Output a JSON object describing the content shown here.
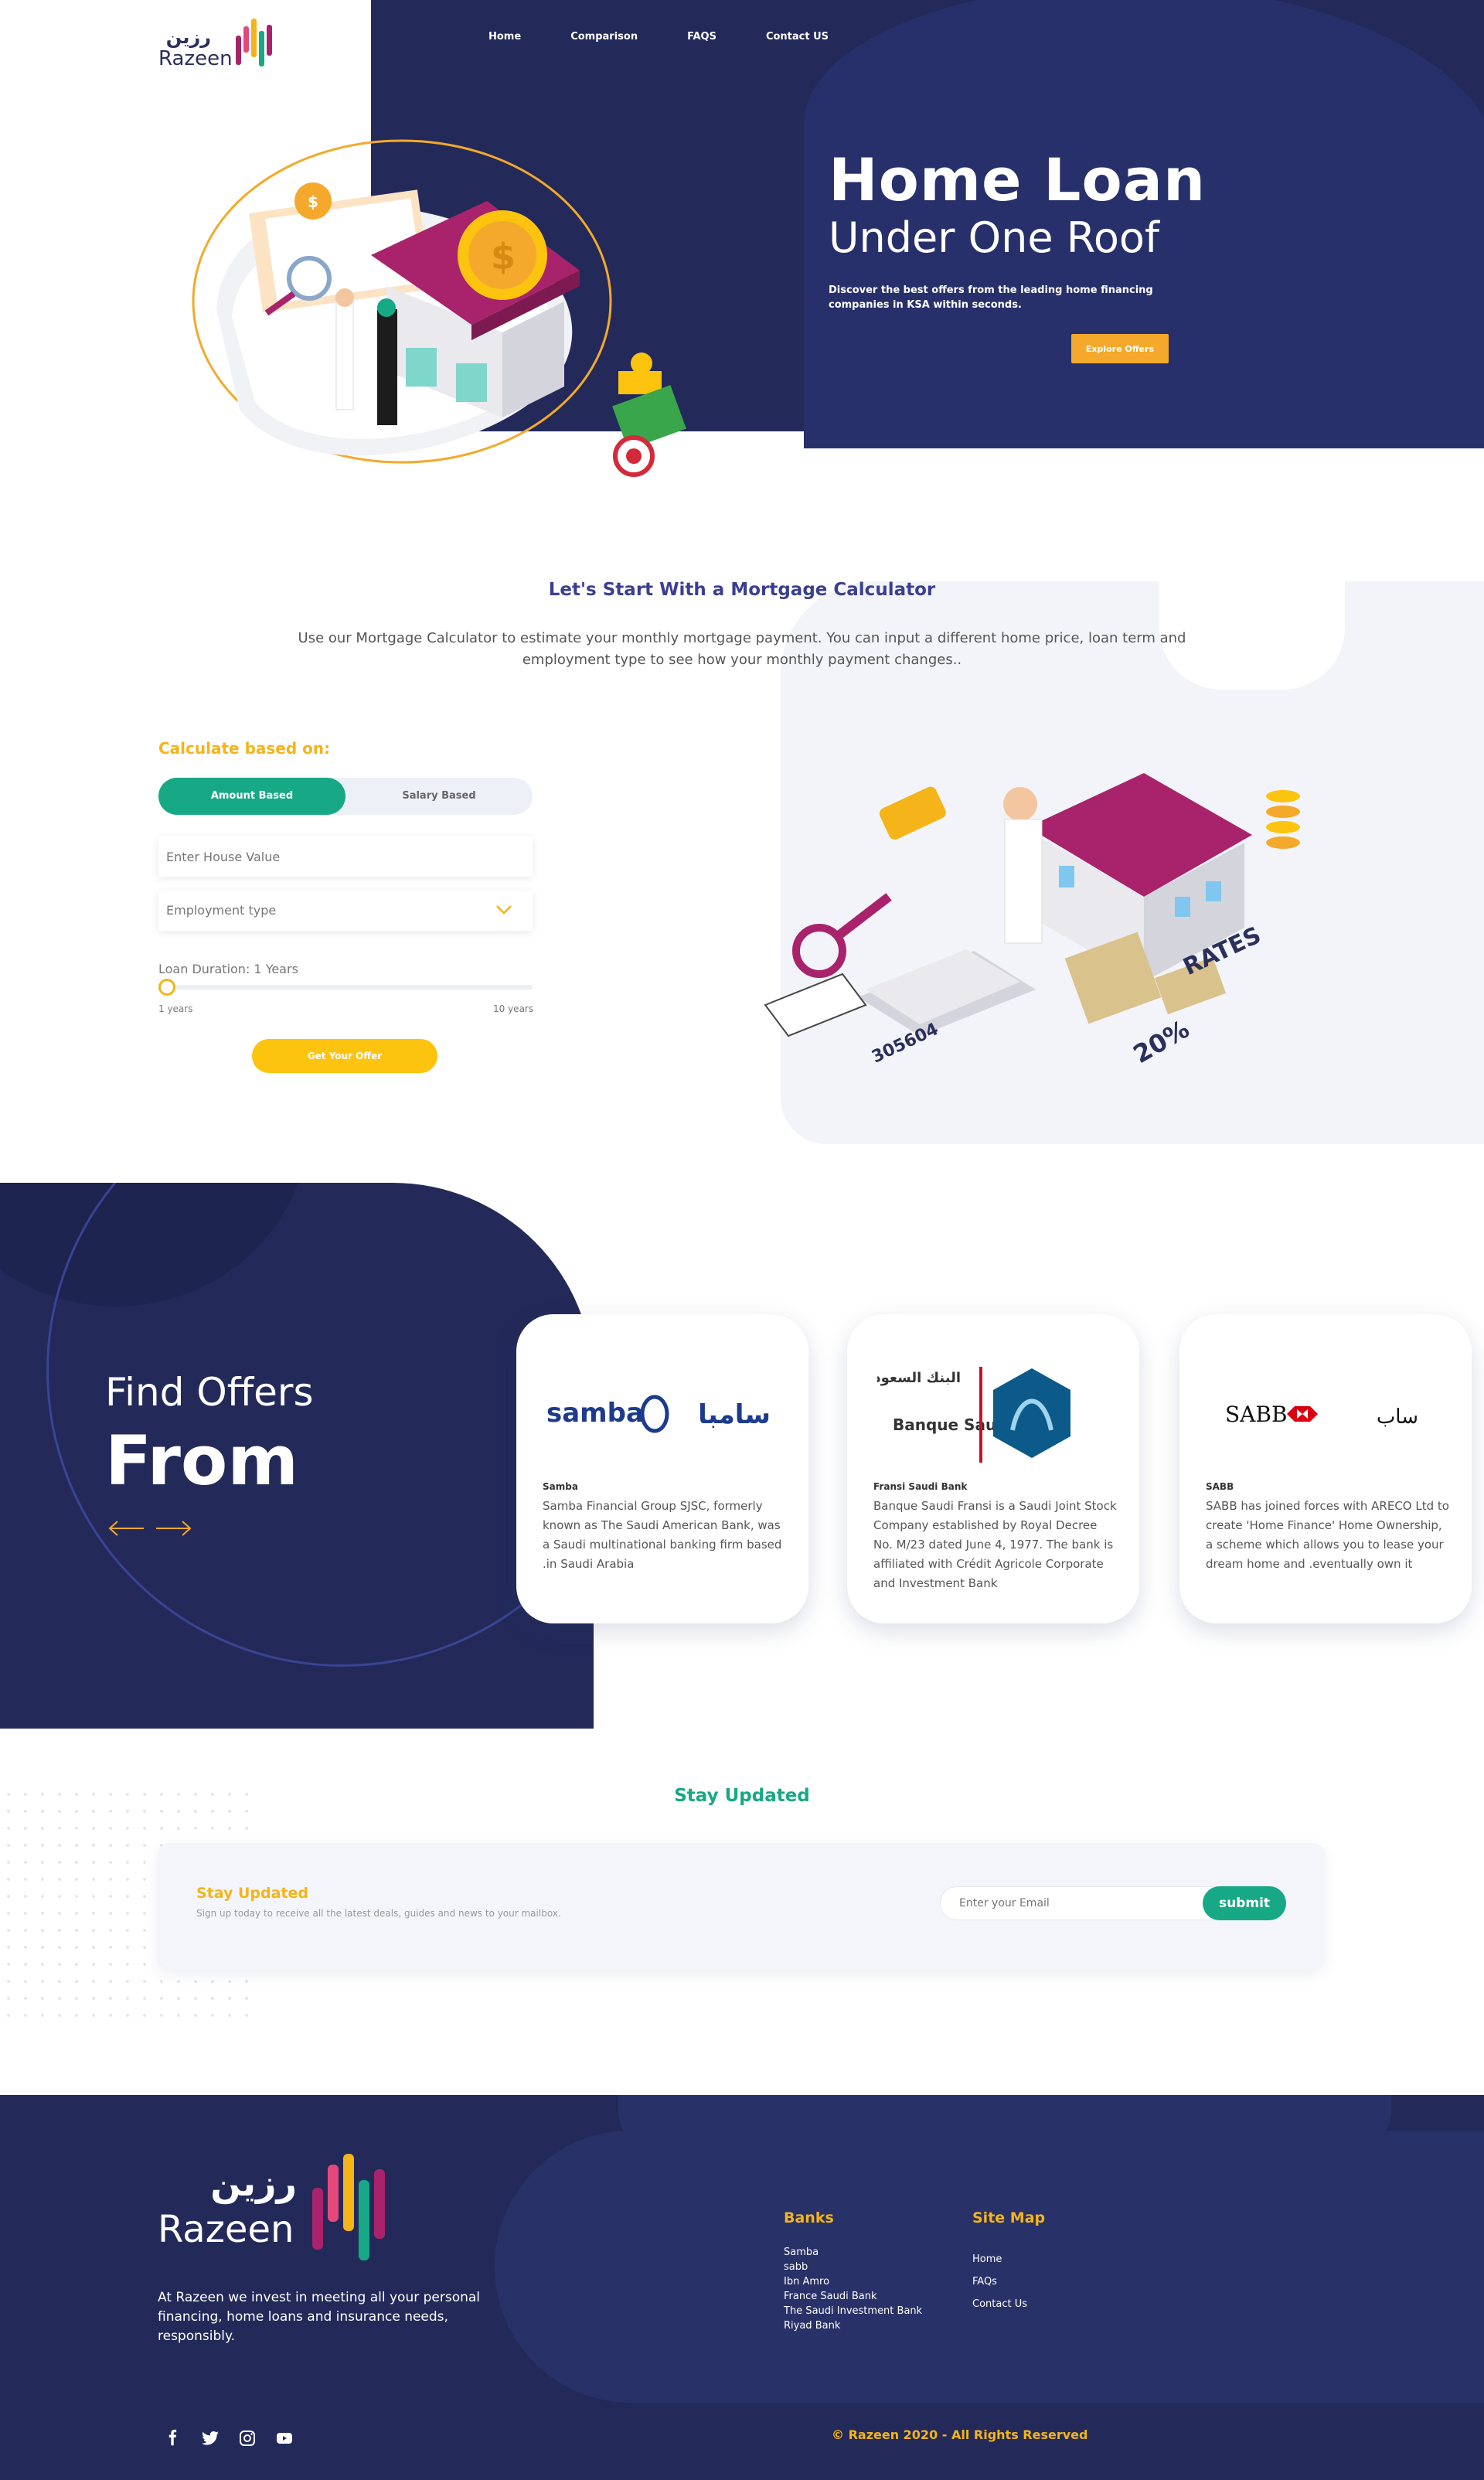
{
  "brand": {
    "name_ar": "رزين",
    "name_en": "Razeen"
  },
  "nav": {
    "items": [
      "Home",
      "Comparison",
      "FAQS",
      "Contact US"
    ]
  },
  "hero": {
    "title": "Home Loan",
    "subtitle": "Under One Roof",
    "description": "Discover the best offers from the leading home financing companies in KSA within seconds.",
    "cta": "Explore Offers"
  },
  "calculator": {
    "title": "Let's Start With a Mortgage Calculator",
    "description": "Use our Mortgage Calculator to estimate your monthly mortgage payment. You can input a different home price, loan term and employment type to see how your monthly payment changes..",
    "based_label": "Calculate based on:",
    "toggle_active": "Amount Based",
    "toggle_inactive": "Salary Based",
    "house_placeholder": "Enter House Value",
    "employment_label": "Employment type",
    "duration_label": "Loan Duration: 1 Years",
    "slider_value": 1,
    "slider_min_label": "1 years",
    "slider_max_label": "10 years",
    "cta": "Get Your Offer",
    "illustration_rates": "RATES",
    "illustration_percent": "20%",
    "illustration_number": "305604"
  },
  "offers": {
    "title_line1": "Find Offers",
    "title_line2": "From",
    "cards": [
      {
        "logo_en": "samba",
        "logo_ar": "سامبا",
        "name": "Samba",
        "text": "Samba Financial Group SJSC, formerly known as The Saudi American Bank, was a Saudi multinational banking firm based .in Saudi Arabia"
      },
      {
        "logo_ar": "البنك السعودي الفرنسي",
        "logo_en": "Banque Saudi Fransi",
        "name": "Fransi Saudi Bank",
        "text": "Banque Saudi Fransi is a Saudi Joint Stock Company established by Royal Decree No. M/23 dated June 4, 1977. The bank is affiliated with Crédit Agricole Corporate and Investment Bank"
      },
      {
        "logo_en": "SABB",
        "logo_ar": "ساب",
        "name": "SABB",
        "text": "SABB has joined forces with ARECO Ltd to create 'Home Finance' Home Ownership, a scheme which allows you to lease your dream home and .eventually own it"
      }
    ]
  },
  "stay": {
    "section_title": "Stay Updated",
    "box_title": "Stay Updated",
    "box_text": "Sign up today to receive all the latest deals, guides and news to your mailbox.",
    "email_placeholder": "Enter your Email",
    "submit": "submit"
  },
  "footer": {
    "about": "At Razeen we invest in meeting all your personal financing, home loans and insurance needs, responsibly.",
    "banks_title": "Banks",
    "banks": [
      "Samba",
      "sabb",
      "Ibn Amro",
      "France Saudi Bank",
      "The Saudi Investment Bank",
      "Riyad Bank"
    ],
    "sitemap_title": "Site Map",
    "sitemap": [
      "Home",
      "FAQs",
      "Contact Us"
    ],
    "socials": [
      "facebook-icon",
      "twitter-icon",
      "instagram-icon",
      "youtube-icon"
    ],
    "copyright": "© Razeen 2020 - All Rights Reserved"
  },
  "colors": {
    "navy": "#232a5a",
    "teal": "#17a886",
    "yellow": "#f4b41a",
    "orange": "#f4a92c",
    "magenta": "#a8236b"
  }
}
